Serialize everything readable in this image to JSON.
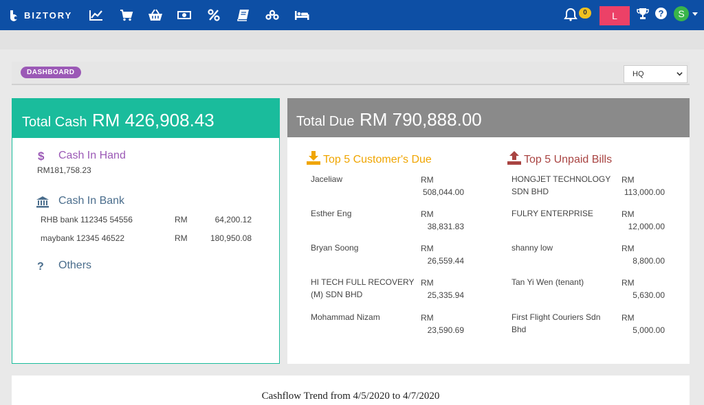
{
  "brand": {
    "name": "BIZTORY"
  },
  "nav": {
    "icons": [
      "chart-line-icon",
      "cart-icon",
      "basket-icon",
      "money-icon",
      "percent-icon",
      "book-icon",
      "coins-icon",
      "bed-icon"
    ],
    "notification_count": "0",
    "user_initial": "L",
    "avatar_initial": "S"
  },
  "dashboard": {
    "label": "DASHBOARD",
    "branch_selected": "HQ"
  },
  "cash": {
    "label": "Total Cash",
    "amount": "RM 426,908.43",
    "hand": {
      "title": "Cash In Hand",
      "amount": "RM181,758.23"
    },
    "bank": {
      "title": "Cash In Bank",
      "accounts": [
        {
          "name": "RHB bank 112345 54556",
          "currency": "RM",
          "amount": "64,200.12"
        },
        {
          "name": "maybank 12345 46522",
          "currency": "RM",
          "amount": "180,950.08"
        }
      ]
    },
    "others": {
      "title": "Others"
    }
  },
  "due": {
    "label": "Total Due",
    "amount": "RM 790,888.00",
    "customers_title": "Top 5 Customer's Due",
    "bills_title": "Top 5 Unpaid Bills",
    "customers": [
      {
        "name": "Jaceliaw",
        "currency": "RM",
        "amount": "508,044.00"
      },
      {
        "name": "Esther Eng",
        "currency": "RM",
        "amount": "38,831.83"
      },
      {
        "name": "Bryan Soong",
        "currency": "RM",
        "amount": "26,559.44"
      },
      {
        "name": "HI TECH FULL RECOVERY (M) SDN BHD",
        "currency": "RM",
        "amount": "25,335.94"
      },
      {
        "name": "Mohammad Nizam",
        "currency": "RM",
        "amount": "23,590.69"
      }
    ],
    "bills": [
      {
        "name": "HONGJET TECHNOLOGY SDN BHD",
        "currency": "RM",
        "amount": "113,000.00"
      },
      {
        "name": "FULRY ENTERPRISE",
        "currency": "RM",
        "amount": "12,000.00"
      },
      {
        "name": "shanny low",
        "currency": "RM",
        "amount": "8,800.00"
      },
      {
        "name": "Tan Yi Wen (tenant)",
        "currency": "RM",
        "amount": "5,630.00"
      },
      {
        "name": "First Flight Couriers Sdn Bhd",
        "currency": "RM",
        "amount": "5,000.00"
      }
    ]
  },
  "trend": {
    "title": "Cashflow Trend from 4/5/2020 to 4/7/2020"
  },
  "colors": {
    "nav": "#0d4fa5",
    "cash_accent": "#1abc9c",
    "due_header": "#8a8a8a",
    "customers_title": "#f0a500",
    "bills_title": "#a94442",
    "user_box": "#ec4167",
    "avatar": "#39b54a",
    "dashboard_pill": "#9b59b6"
  }
}
